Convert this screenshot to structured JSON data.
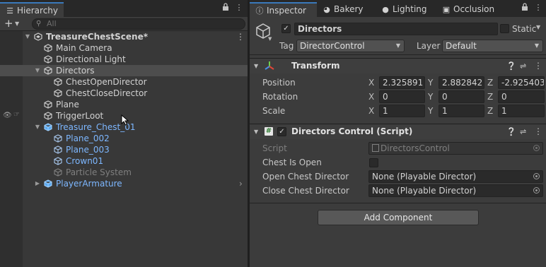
{
  "hierarchy": {
    "tab_label": "Hierarchy",
    "search_placeholder": "All",
    "items": [
      {
        "label": "TreasureChestScene*",
        "depth": 0,
        "type": "scene",
        "expanded": true,
        "style": "bold"
      },
      {
        "label": "Main Camera",
        "depth": 1,
        "type": "cube",
        "style": "normal"
      },
      {
        "label": "Directional Light",
        "depth": 1,
        "type": "cube",
        "style": "normal"
      },
      {
        "label": "Directors",
        "depth": 1,
        "type": "cube",
        "expanded": true,
        "style": "normal",
        "selected": true
      },
      {
        "label": "ChestOpenDirector",
        "depth": 2,
        "type": "cube",
        "style": "normal"
      },
      {
        "label": "ChestCloseDirector",
        "depth": 2,
        "type": "cube",
        "style": "normal"
      },
      {
        "label": "Plane",
        "depth": 1,
        "type": "cube",
        "style": "normal"
      },
      {
        "label": "TriggerLoot",
        "depth": 1,
        "type": "cube",
        "style": "normal",
        "hover": true
      },
      {
        "label": "Treasure_Chest_01",
        "depth": 1,
        "type": "prefab",
        "expanded": true,
        "style": "blue"
      },
      {
        "label": "Plane_002",
        "depth": 2,
        "type": "cube-outline",
        "style": "blue"
      },
      {
        "label": "Plane_003",
        "depth": 2,
        "type": "cube-outline",
        "style": "blue"
      },
      {
        "label": "Crown01",
        "depth": 2,
        "type": "cube-outline",
        "style": "blue"
      },
      {
        "label": "Particle System",
        "depth": 2,
        "type": "cube-outline",
        "style": "grey"
      },
      {
        "label": "PlayerArmature",
        "depth": 1,
        "type": "prefab",
        "expanded": false,
        "style": "blue",
        "has_child_arrow": true
      }
    ]
  },
  "inspector_tabs": [
    {
      "label": "Inspector",
      "icon": "info-icon",
      "active": true
    },
    {
      "label": "Bakery",
      "icon": "bakery-icon"
    },
    {
      "label": "Lighting",
      "icon": "bulb-icon"
    },
    {
      "label": "Occlusion",
      "icon": "occlusion-icon"
    }
  ],
  "inspector": {
    "object_name": "Directors",
    "active": true,
    "static_label": "Static",
    "tag_label": "Tag",
    "tag_value": "DirectorControl",
    "layer_label": "Layer",
    "layer_value": "Default",
    "transform": {
      "title": "Transform",
      "position_label": "Position",
      "rotation_label": "Rotation",
      "scale_label": "Scale",
      "position": {
        "x": "2.325891",
        "y": "2.882842",
        "z": "-2.925403"
      },
      "rotation": {
        "x": "0",
        "y": "0",
        "z": "0"
      },
      "scale": {
        "x": "1",
        "y": "1",
        "z": "1"
      },
      "axis_x": "X",
      "axis_y": "Y",
      "axis_z": "Z"
    },
    "script_component": {
      "title": "Directors Control (Script)",
      "enabled": true,
      "script_label": "Script",
      "script_value": "DirectorsControl",
      "chest_is_open_label": "Chest Is Open",
      "chest_is_open": false,
      "open_director_label": "Open Chest Director",
      "open_director_value": "None (Playable Director)",
      "close_director_label": "Close Chest Director",
      "close_director_value": "None (Playable Director)"
    },
    "add_component_label": "Add Component"
  },
  "colors": {
    "accent_tab": "#3a79bb",
    "prefab_blue": "#7db7ff",
    "panel_bg": "#3c3c3c"
  }
}
